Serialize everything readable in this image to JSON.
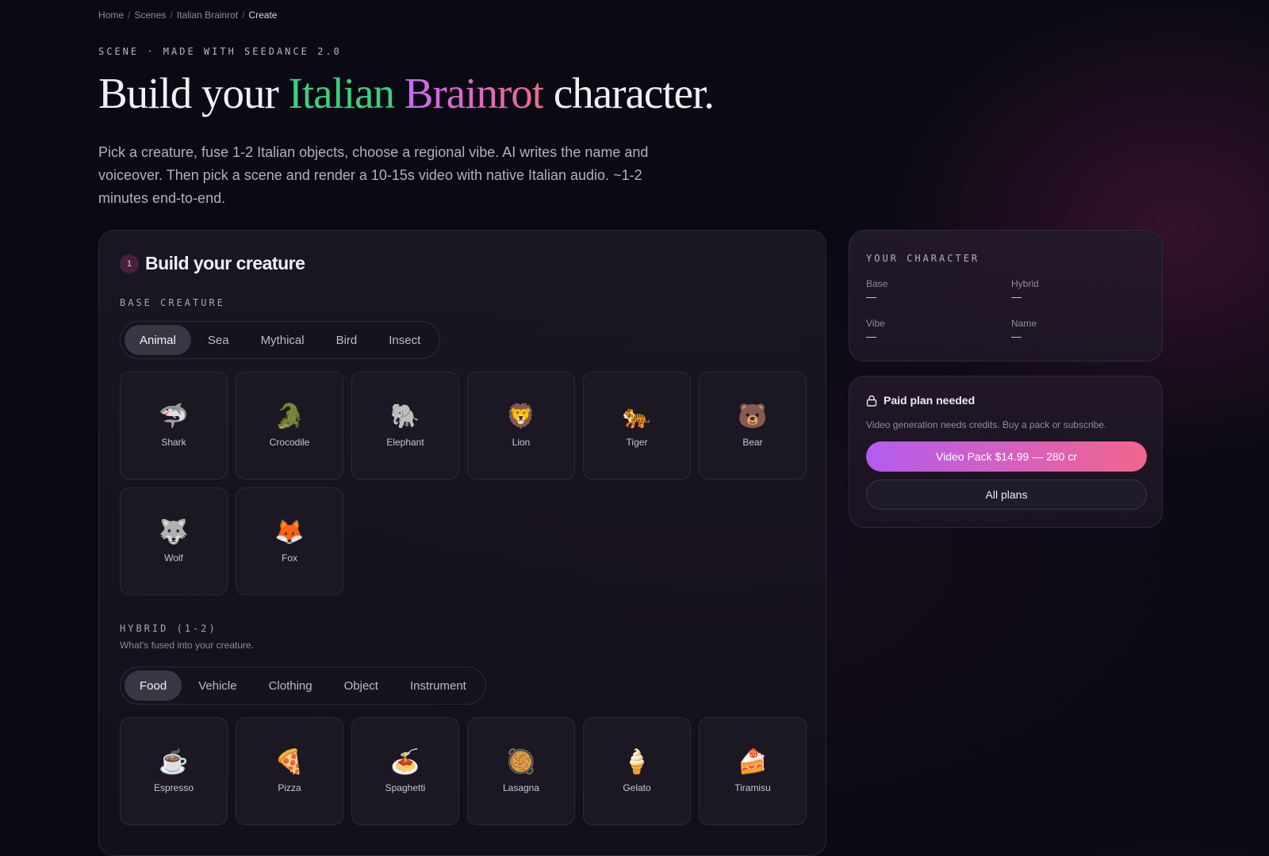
{
  "breadcrumb": [
    {
      "label": "Home"
    },
    {
      "label": "Scenes"
    },
    {
      "label": "Italian Brainrot"
    },
    {
      "label": "Create"
    }
  ],
  "breadcrumb_separator": "/",
  "hero": {
    "eyebrow": "SCENE · MADE WITH SEEDANCE 2.0",
    "title_pre": "Build your ",
    "title_green": "Italian",
    "title_pink": "Brainrot",
    "title_post": " character.",
    "description": "Pick a creature, fuse 1-2 Italian objects, choose a regional vibe. AI writes the name and voiceover. Then pick a scene and render a 10-15s video with native Italian audio. ~1-2 minutes end-to-end."
  },
  "builder": {
    "step_number": "1",
    "step_title": "Build your creature",
    "base": {
      "label": "BASE CREATURE",
      "tabs": [
        "Animal",
        "Sea",
        "Mythical",
        "Bird",
        "Insect"
      ],
      "active_tab": "Animal",
      "items": [
        {
          "emoji": "🦈",
          "label": "Shark"
        },
        {
          "emoji": "🐊",
          "label": "Crocodile"
        },
        {
          "emoji": "🐘",
          "label": "Elephant"
        },
        {
          "emoji": "🦁",
          "label": "Lion"
        },
        {
          "emoji": "🐅",
          "label": "Tiger"
        },
        {
          "emoji": "🐻",
          "label": "Bear"
        },
        {
          "emoji": "🐺",
          "label": "Wolf"
        },
        {
          "emoji": "🦊",
          "label": "Fox"
        }
      ]
    },
    "hybrid": {
      "label": "HYBRID (1-2)",
      "sub": "What's fused into your creature.",
      "tabs": [
        "Food",
        "Vehicle",
        "Clothing",
        "Object",
        "Instrument"
      ],
      "active_tab": "Food",
      "items": [
        {
          "emoji": "☕",
          "label": "Espresso"
        },
        {
          "emoji": "🍕",
          "label": "Pizza"
        },
        {
          "emoji": "🍝",
          "label": "Spaghetti"
        },
        {
          "emoji": "🥘",
          "label": "Lasagna"
        },
        {
          "emoji": "🍦",
          "label": "Gelato"
        },
        {
          "emoji": "🍰",
          "label": "Tiramisu"
        }
      ]
    }
  },
  "character": {
    "title": "YOUR CHARACTER",
    "fields": [
      {
        "key": "Base",
        "value": "—"
      },
      {
        "key": "Hybrid",
        "value": "—"
      },
      {
        "key": "Vibe",
        "value": "—"
      },
      {
        "key": "Name",
        "value": "—"
      }
    ]
  },
  "plan": {
    "icon": "lock-icon",
    "title": "Paid plan needed",
    "description": "Video generation needs credits. Buy a pack or subscribe.",
    "primary_label": "Video Pack $14.99 — 280 cr",
    "secondary_label": "All plans"
  },
  "colors": {
    "accent_green": "#3ecf7e",
    "accent_gradient_start": "#b45cf0",
    "accent_gradient_end": "#f2658e",
    "background": "#0b0a14"
  }
}
